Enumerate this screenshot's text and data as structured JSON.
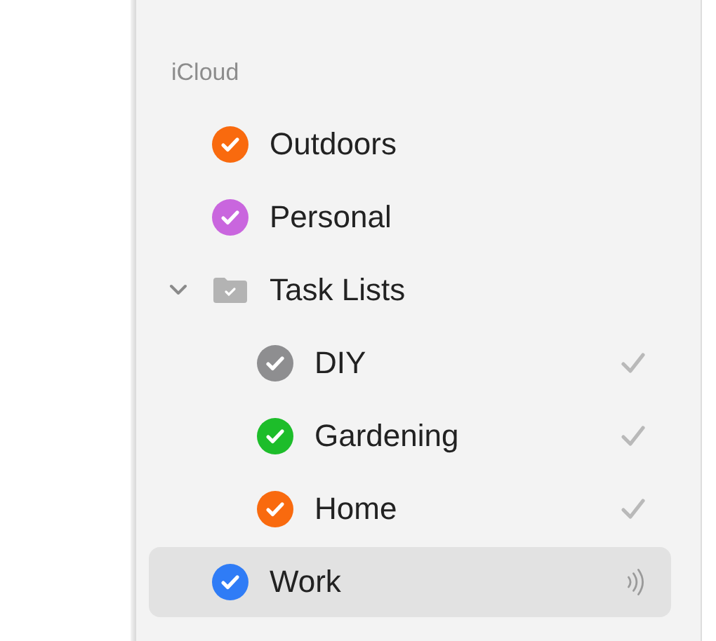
{
  "sidebar": {
    "section": "iCloud",
    "items": [
      {
        "kind": "list",
        "label": "Outdoors",
        "color": "#f96a0e",
        "selected": false
      },
      {
        "kind": "list",
        "label": "Personal",
        "color": "#c966de",
        "selected": false
      },
      {
        "kind": "group",
        "label": "Task Lists",
        "expanded": true,
        "selected": false,
        "children": [
          {
            "kind": "list",
            "label": "DIY",
            "color": "#8e8e90",
            "selected": false,
            "checked": true
          },
          {
            "kind": "list",
            "label": "Gardening",
            "color": "#1dbd2a",
            "selected": false,
            "checked": true
          },
          {
            "kind": "list",
            "label": "Home",
            "color": "#f96a0e",
            "selected": false,
            "checked": true
          }
        ]
      },
      {
        "kind": "list",
        "label": "Work",
        "color": "#2f7cf6",
        "selected": true,
        "shared": true
      }
    ]
  }
}
